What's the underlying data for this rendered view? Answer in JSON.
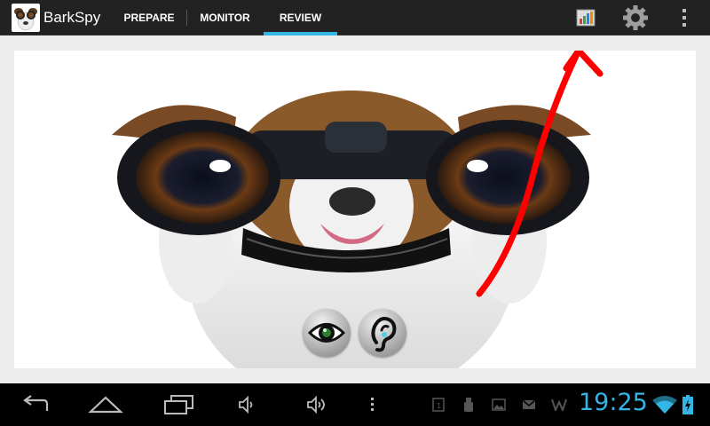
{
  "app": {
    "title": "BarkSpy"
  },
  "tabs": [
    {
      "label": "PREPARE",
      "active": false
    },
    {
      "label": "MONITOR",
      "active": false
    },
    {
      "label": "REVIEW",
      "active": true
    }
  ],
  "actions": {
    "stats_icon": "bar-chart-icon",
    "settings_icon": "gear-icon",
    "overflow_icon": "more-vert-icon"
  },
  "main": {
    "image": "dog-with-binoculars",
    "buttons": [
      {
        "icon": "eye-icon"
      },
      {
        "icon": "ear-icon"
      }
    ],
    "annotation": "red-arrow"
  },
  "system": {
    "clock": "19:25",
    "accent": "#33b5e5",
    "annotation_color": "#ff0000"
  },
  "nav": [
    "back-icon",
    "home-icon",
    "recent-apps-icon",
    "volume-down-icon",
    "volume-up-icon",
    "menu-icon"
  ],
  "notifications": [
    "screenshot-icon",
    "usb-icon",
    "image-icon",
    "gmail-icon",
    "w-icon",
    "wifi-icon",
    "battery-icon"
  ]
}
